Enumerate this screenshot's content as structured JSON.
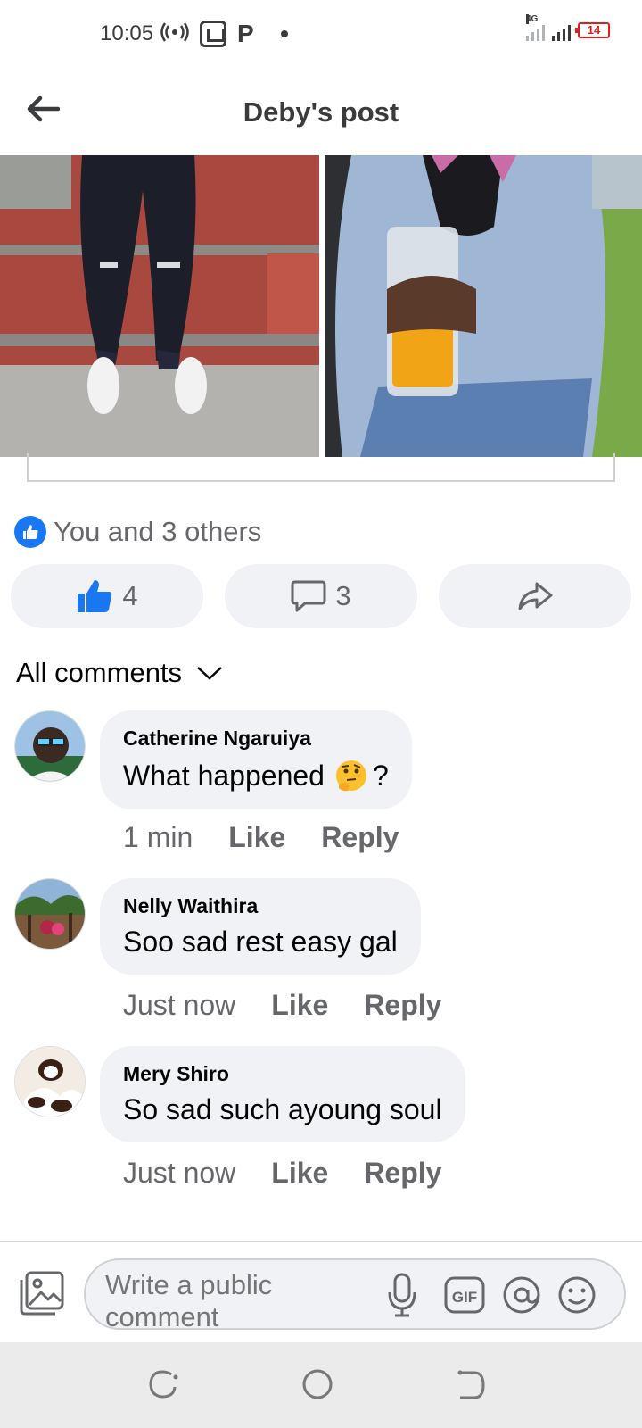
{
  "status_bar": {
    "time": "10:05",
    "network_type": "4G",
    "battery_level": "14"
  },
  "header": {
    "title": "Deby's post"
  },
  "reactions": {
    "summary": "You and 3 others",
    "like_count": "4",
    "comment_count": "3"
  },
  "comments_filter": {
    "label": "All comments"
  },
  "comments": [
    {
      "author": "Catherine Ngaruiya",
      "text": "What happened",
      "text_suffix": "?",
      "emoji": "thinking-face",
      "time": "1 min",
      "like_label": "Like",
      "reply_label": "Reply"
    },
    {
      "author": "Nelly Waithira",
      "text": "Soo sad rest easy gal",
      "time": "Just now",
      "like_label": "Like",
      "reply_label": "Reply"
    },
    {
      "author": "Mery Shiro",
      "text": "So sad such ayoung soul",
      "time": "Just now",
      "like_label": "Like",
      "reply_label": "Reply"
    }
  ],
  "composer": {
    "placeholder": "Write a public comment"
  },
  "colors": {
    "facebook_blue": "#1877f2",
    "bubble_gray": "#f0f2f5",
    "secondary_text": "#65676b",
    "battery_red": "#e41e1e"
  }
}
